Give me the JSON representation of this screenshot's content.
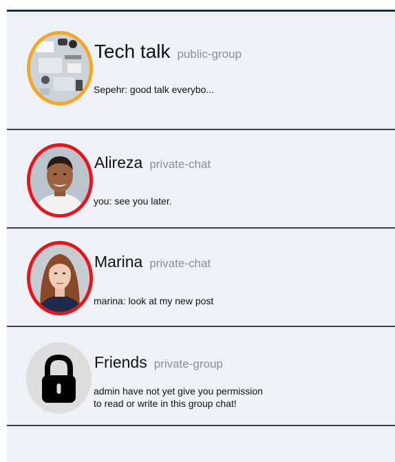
{
  "chats": [
    {
      "name": "Tech talk",
      "type": "public-group",
      "preview": "Sepehr: good talk everybo...",
      "avatar": "desk-workspace-photo",
      "ring_color": "#f5a623"
    },
    {
      "name": "Alireza",
      "type": "private-chat",
      "preview": "you: see you later.",
      "avatar": "man-portrait-photo",
      "ring_color": "#e8141b"
    },
    {
      "name": "Marina",
      "type": "private-chat",
      "preview": "marina: look at my new post",
      "avatar": "woman-portrait-photo",
      "ring_color": "#e8141b"
    },
    {
      "name": "Friends",
      "type": "private-group",
      "preview_lines": [
        "admin have not yet give you permission",
        "to read or write in this group chat!"
      ],
      "avatar": "lock-icon",
      "avatar_bg": "#dddddd"
    }
  ]
}
